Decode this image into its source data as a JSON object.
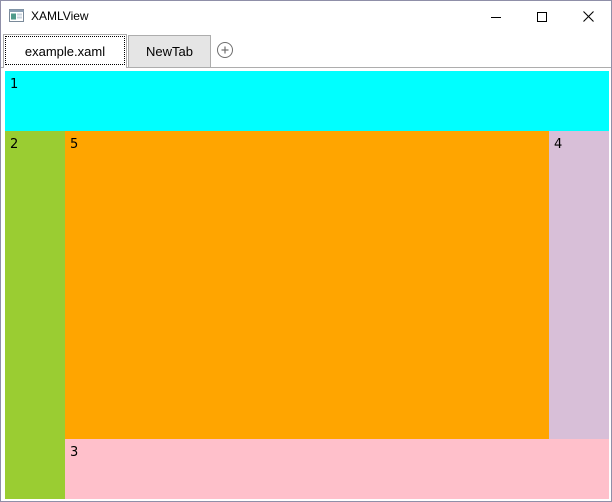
{
  "window": {
    "title": "XAMLView",
    "icon": "app-window-icon",
    "controls": [
      "minimize-icon",
      "maximize-icon",
      "close-icon"
    ]
  },
  "tabs": [
    {
      "label": "example.xaml",
      "active": true
    },
    {
      "label": "NewTab",
      "active": false
    }
  ],
  "add_tab_icon": "add-circle-icon",
  "grid": {
    "cells": [
      {
        "label": "1",
        "color": "#00ffff"
      },
      {
        "label": "2",
        "color": "#9acd32"
      },
      {
        "label": "3",
        "color": "#ffc0cb"
      },
      {
        "label": "4",
        "color": "#d8bfd8"
      },
      {
        "label": "5",
        "color": "#ffa500"
      }
    ]
  }
}
